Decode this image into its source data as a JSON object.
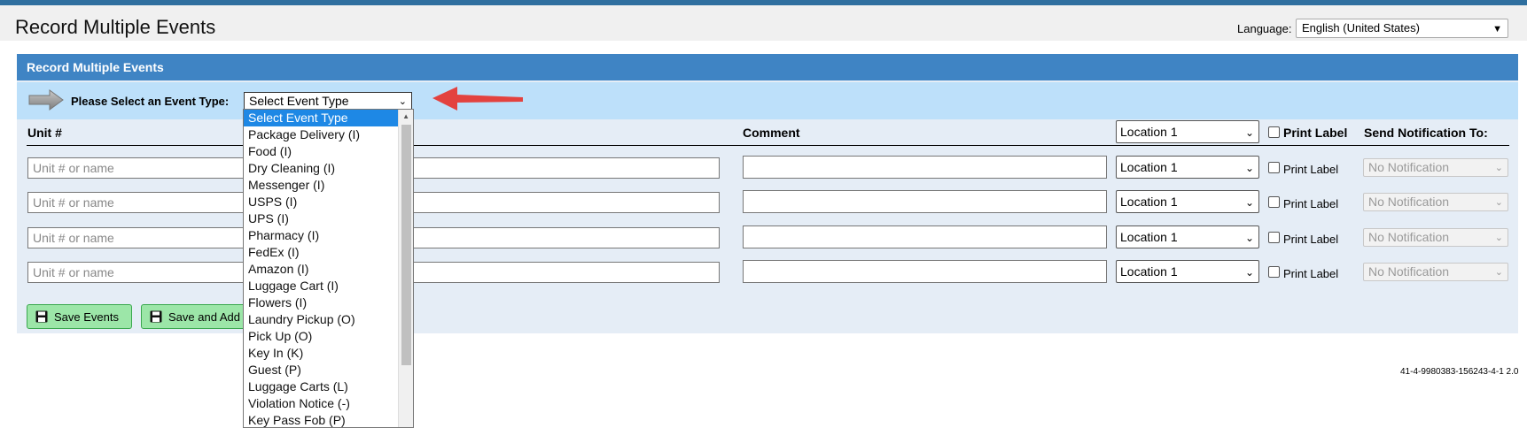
{
  "header": {
    "title": "Record Multiple Events",
    "language_label": "Language:",
    "language_value": "English (United States)"
  },
  "panel": {
    "title": "Record Multiple Events",
    "event_type_label": "Please Select an Event Type:",
    "event_type_value": "Select Event Type"
  },
  "table": {
    "unit_header": "Unit #",
    "comment_header": "Comment",
    "location_header_value": "Location 1",
    "print_label_header": "Print Label",
    "send_notification_header": "Send Notification To:",
    "rows": [
      {
        "unit_placeholder": "Unit # or name",
        "location": "Location 1",
        "print_label": "Print Label",
        "notification": "No Notification"
      },
      {
        "unit_placeholder": "Unit # or name",
        "location": "Location 1",
        "print_label": "Print Label",
        "notification": "No Notification"
      },
      {
        "unit_placeholder": "Unit # or name",
        "location": "Location 1",
        "print_label": "Print Label",
        "notification": "No Notification"
      },
      {
        "unit_placeholder": "Unit # or name",
        "location": "Location 1",
        "print_label": "Print Label",
        "notification": "No Notification"
      }
    ]
  },
  "buttons": {
    "save_events": "Save Events",
    "save_and_add": "Save and Add"
  },
  "dropdown": {
    "options": [
      "Select Event Type",
      "Package Delivery (I)",
      "Food (I)",
      "Dry Cleaning (I)",
      "Messenger (I)",
      "USPS (I)",
      "UPS (I)",
      "Pharmacy (I)",
      "FedEx (I)",
      "Amazon (I)",
      "Luggage Cart (I)",
      "Flowers (I)",
      "Laundry Pickup (O)",
      "Pick Up (O)",
      "Key In (K)",
      "Guest (P)",
      "Luggage Carts (L)",
      "Violation Notice (-)",
      "Key Pass Fob (P)"
    ],
    "selected_index": 0
  },
  "footer": {
    "build_code": "41-4-9980383-156243-4-1 2.0"
  },
  "colors": {
    "top_bar": "#2f6f9f",
    "panel_header": "#3f84c4",
    "event_bar": "#bde0fa",
    "button_green": "#9ce6a8",
    "selection_blue": "#1e88e5",
    "annotation_arrow": "#e53935"
  },
  "icons": {
    "event_type_arrow": "gray-arrow-icon",
    "annotation": "red-arrow-icon",
    "save": "floppy-disk-icon"
  }
}
